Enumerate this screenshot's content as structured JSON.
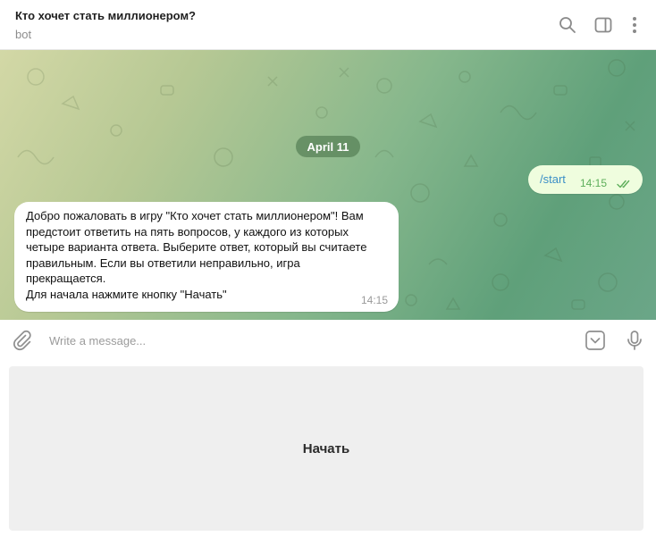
{
  "header": {
    "title": "Кто хочет стать миллионером?",
    "subtitle": "bot",
    "icons": [
      "search-icon",
      "sidebar-toggle-icon",
      "more-vertical-icon"
    ]
  },
  "chat": {
    "date_label": "April 11",
    "outgoing": {
      "text": "/start",
      "time": "14:15",
      "status": "read"
    },
    "incoming": {
      "lines": [
        "Добро пожаловать в игру \"Кто хочет стать миллионером\"! Вам",
        "предстоит ответить на пять вопросов, у каждого из которых",
        "четыре варианта ответа. Выберите ответ, который вы считаете",
        "правильным. Если вы ответили неправильно, игра",
        "прекращается.",
        "Для начала нажмите кнопку \"Начать\""
      ],
      "time": "14:15"
    }
  },
  "composer": {
    "placeholder": "Write a message...",
    "value": "",
    "icons": [
      "attach-icon",
      "bot-keyboard-icon",
      "microphone-icon"
    ]
  },
  "reply_keyboard": {
    "buttons": [
      "Начать"
    ]
  },
  "colors": {
    "outgoing_bubble": "#effdde",
    "incoming_bubble": "#ffffff",
    "link": "#3a8fc7",
    "read_ticks": "#5dae5a",
    "date_pill": "#5a8a5a",
    "keyboard_button": "#efefef"
  }
}
